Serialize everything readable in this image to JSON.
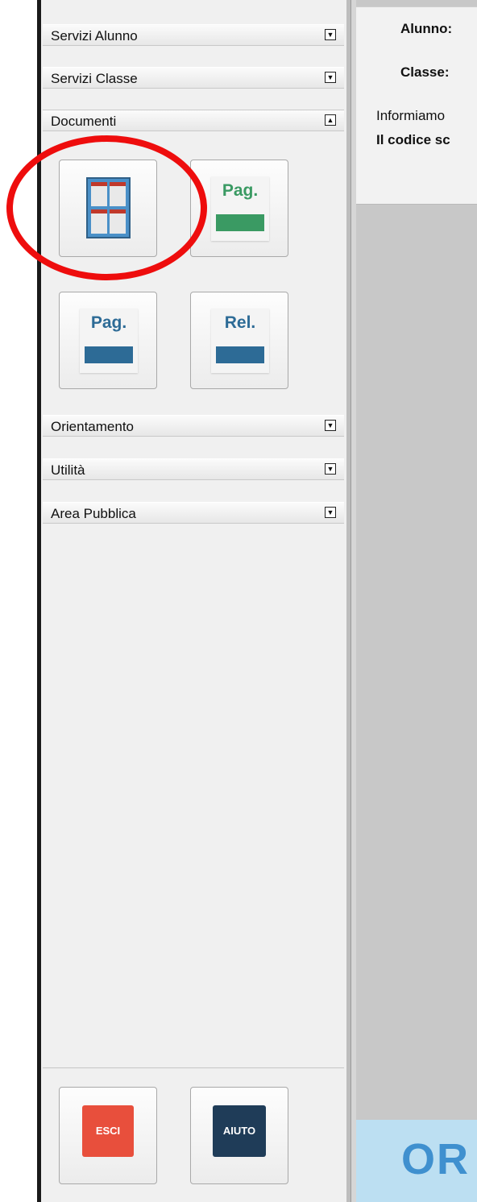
{
  "sidebar": {
    "sections": [
      {
        "label": "Servizi Alunno",
        "toggle": "▼"
      },
      {
        "label": "Servizi Classe",
        "toggle": "▼"
      },
      {
        "label": "Documenti",
        "toggle": "▲"
      },
      {
        "label": "Orientamento",
        "toggle": "▼"
      },
      {
        "label": "Utilità",
        "toggle": "▼"
      },
      {
        "label": "Area Pubblica",
        "toggle": "▼"
      }
    ],
    "documenti_tiles": [
      {
        "icon": "documents-grid-icon",
        "text": ""
      },
      {
        "icon": "pagella-green-icon",
        "text": "Pag."
      },
      {
        "icon": "pagella-blue-icon",
        "text": "Pag."
      },
      {
        "icon": "relazione-blue-icon",
        "text": "Rel."
      }
    ],
    "footer_buttons": [
      {
        "label": "ESCI",
        "color": "#e84f3c"
      },
      {
        "label": "AIUTO",
        "color": "#1f3c58"
      }
    ]
  },
  "colors": {
    "highlight_ring": "#ee0d0d",
    "pag_green": "#3a9a63",
    "pag_blue": "#2d6b96"
  },
  "main": {
    "header": {
      "alunno_label": "Alunno:",
      "classe_label": "Classe:",
      "info_text": "Informiamo",
      "codice_text": "Il codice sc"
    },
    "footer_logo_text": "OR"
  }
}
